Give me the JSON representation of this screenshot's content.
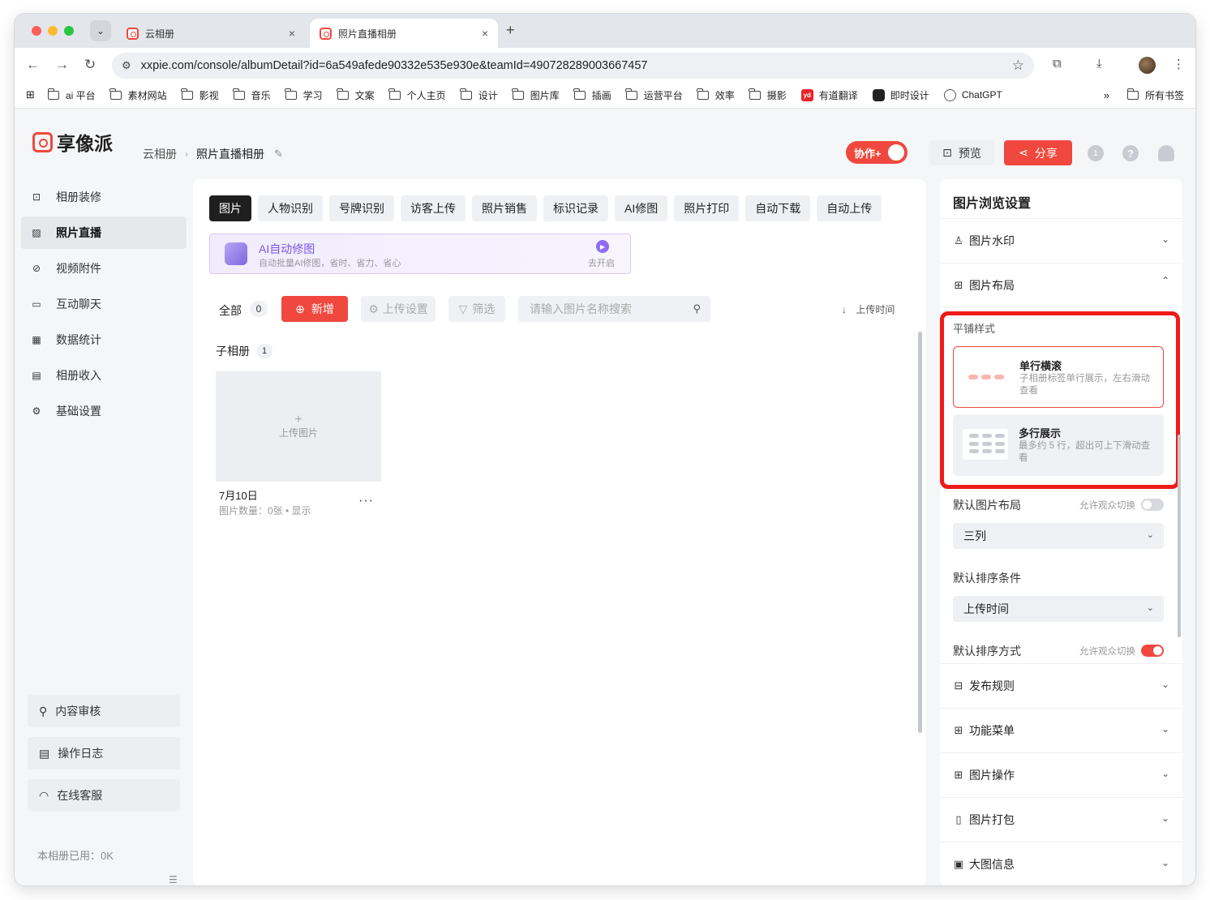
{
  "browser": {
    "tabs": [
      {
        "title": "云相册",
        "close": "×"
      },
      {
        "title": "照片直播相册",
        "close": "×"
      }
    ],
    "new_tab": "+",
    "menu_chevron": "⌄",
    "url": "xxpie.com/console/albumDetail?id=6a549afede90332e535e930e&teamId=490728289003667457",
    "bookmarks": [
      {
        "label": "ai 平台",
        "icon": "folder-icon"
      },
      {
        "label": "素材网站",
        "icon": "folder-icon"
      },
      {
        "label": "影视",
        "icon": "folder-icon"
      },
      {
        "label": "音乐",
        "icon": "folder-icon"
      },
      {
        "label": "学习",
        "icon": "folder-icon"
      },
      {
        "label": "文案",
        "icon": "folder-icon"
      },
      {
        "label": "个人主页",
        "icon": "folder-icon"
      },
      {
        "label": "设计",
        "icon": "folder-icon"
      },
      {
        "label": "图片库",
        "icon": "folder-icon"
      },
      {
        "label": "插画",
        "icon": "folder-icon"
      },
      {
        "label": "运营平台",
        "icon": "folder-icon"
      },
      {
        "label": "效率",
        "icon": "folder-icon"
      },
      {
        "label": "摄影",
        "icon": "folder-icon"
      },
      {
        "label": "有道翻译",
        "icon": "youdao-icon",
        "badge": "yd"
      },
      {
        "label": "即时设计",
        "icon": "jishi-icon"
      },
      {
        "label": "ChatGPT",
        "icon": "chatgpt-icon"
      }
    ],
    "more": "»",
    "all_bookmarks": "所有书签"
  },
  "header": {
    "logo_text": "享像派",
    "breadcrumb": [
      "云相册",
      "照片直播相册"
    ],
    "collab_label": "协作+",
    "preview_label": "预览",
    "share_label": "分享",
    "level_badge": "1",
    "help": "?"
  },
  "sidebar": {
    "items": [
      {
        "label": "相册装修",
        "icon": "decor-icon"
      },
      {
        "label": "照片直播",
        "icon": "image-icon",
        "active": true
      },
      {
        "label": "视频附件",
        "icon": "attachment-icon"
      },
      {
        "label": "互动聊天",
        "icon": "chat-icon"
      },
      {
        "label": "数据统计",
        "icon": "stats-icon"
      },
      {
        "label": "相册收入",
        "icon": "income-icon"
      },
      {
        "label": "基础设置",
        "icon": "settings-icon"
      }
    ],
    "bottom": [
      {
        "label": "内容审核",
        "icon": "stamp-icon"
      },
      {
        "label": "操作日志",
        "icon": "log-icon"
      },
      {
        "label": "在线客服",
        "icon": "headset-icon"
      }
    ],
    "usage": "本相册已用：0K"
  },
  "main": {
    "feature_tabs": [
      "图片",
      "人物识别",
      "号牌识别",
      "访客上传",
      "照片销售",
      "标识记录",
      "AI修图",
      "照片打印",
      "自动下载",
      "自动上传"
    ],
    "ai_banner": {
      "title": "AI自动修图",
      "subtitle": "自动批量AI修图，省时、省力、省心",
      "action": "去开启"
    },
    "filter": {
      "all_label": "全部",
      "all_count": "0",
      "add_label": "新增",
      "upload_settings": "上传设置",
      "filter_label": "筛选",
      "search_placeholder": "请输入图片名称搜索",
      "sort_label": "上传时间"
    },
    "sub_albums": {
      "title": "子相册",
      "count": "1",
      "card_upload": "上传图片",
      "name": "7月10日",
      "meta": "图片数量：0张 • 显示",
      "more": "···"
    }
  },
  "right_panel": {
    "title": "图片浏览设置",
    "sections_top": [
      {
        "label": "图片水印",
        "icon": "watermark-icon",
        "expanded": false
      },
      {
        "label": "图片布局",
        "icon": "layout-icon",
        "expanded": true
      }
    ],
    "tile_style_label": "平铺样式",
    "options": [
      {
        "title": "单行横滚",
        "desc": "子相册标签单行展示，左右滑动查看",
        "selected": true
      },
      {
        "title": "多行展示",
        "desc": "最多约 5 行，超出可上下滑动查看",
        "selected": false
      }
    ],
    "default_layout": {
      "label": "默认图片布局",
      "allow": "允许观众切换",
      "toggle_on": false,
      "value": "三列"
    },
    "default_sort": {
      "label": "默认排序条件",
      "value": "上传时间"
    },
    "default_order": {
      "label": "默认排序方式",
      "allow": "允许观众切换",
      "toggle_on": true
    },
    "sections_bottom": [
      {
        "label": "发布规则",
        "icon": "publish-icon"
      },
      {
        "label": "功能菜单",
        "icon": "menu-icon"
      },
      {
        "label": "图片操作",
        "icon": "grid-icon"
      },
      {
        "label": "图片打包",
        "icon": "package-icon"
      },
      {
        "label": "大图信息",
        "icon": "info-icon"
      }
    ],
    "highlight_color": "#ef1a1a"
  },
  "colors": {
    "brand": "#f0483e",
    "ai_purple": "#7a55e6"
  }
}
